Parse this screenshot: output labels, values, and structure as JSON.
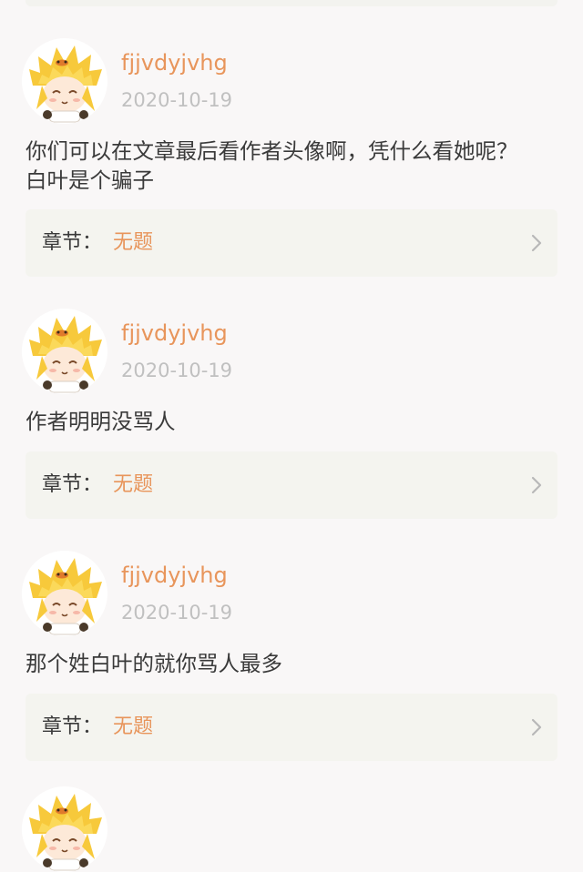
{
  "comments": [
    {
      "username": "fjjvdyjvhg",
      "date": "2020-10-19",
      "text": "你们可以在文章最后看作者头像啊，凭什么看她呢？\n白叶是个骗子",
      "chapter_label": "章节：",
      "chapter_value": "无题"
    },
    {
      "username": "fjjvdyjvhg",
      "date": "2020-10-19",
      "text": "作者明明没骂人",
      "chapter_label": "章节：",
      "chapter_value": "无题"
    },
    {
      "username": "fjjvdyjvhg",
      "date": "2020-10-19",
      "text": "那个姓白叶的就你骂人最多",
      "chapter_label": "章节：",
      "chapter_value": "无题"
    }
  ],
  "icons": {
    "avatar": "anime-avatar-icon",
    "chevron": "chevron-right-icon"
  },
  "colors": {
    "username": "#e8955b",
    "date": "#c0c0c0",
    "text": "#3a3a3a",
    "chapter_bar": "#f4f4ef",
    "background": "#f9f7f7"
  }
}
